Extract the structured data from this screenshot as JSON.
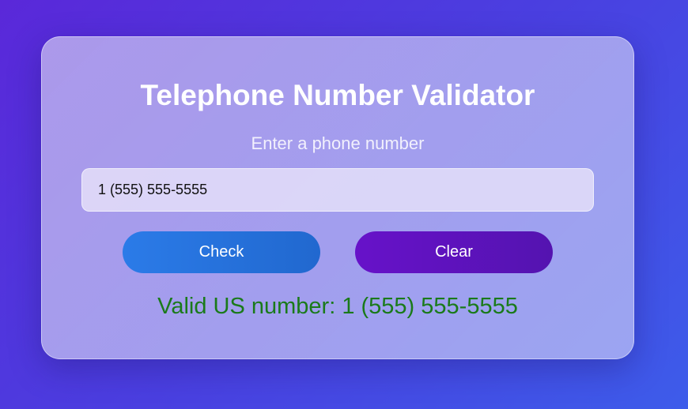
{
  "app": {
    "title": "Telephone Number Validator",
    "subtitle": "Enter a phone number"
  },
  "input": {
    "value": "1 (555) 555-5555",
    "placeholder": ""
  },
  "buttons": {
    "check_label": "Check",
    "clear_label": "Clear"
  },
  "result": {
    "text": "Valid US number: 1 (555) 555-5555",
    "color": "#1a7a1a"
  },
  "colors": {
    "check_button": "#2b7be8",
    "clear_button": "#6712c9",
    "background": "#5a28d9"
  }
}
